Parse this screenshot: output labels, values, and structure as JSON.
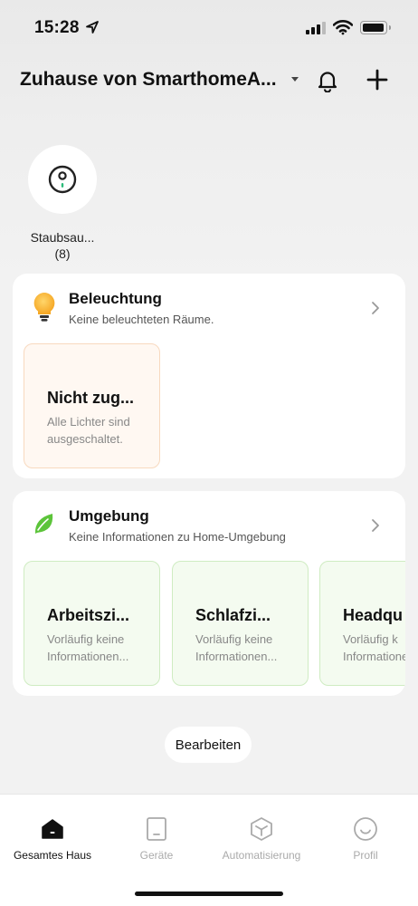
{
  "status_bar": {
    "time": "15:28"
  },
  "header": {
    "home_name": "Zuhause von SmarthomeA..."
  },
  "device_shortcut": {
    "name": "Staubsau...",
    "count": "(8)"
  },
  "lighting_card": {
    "title": "Beleuchtung",
    "subtitle": "Keine beleuchteten Räume.",
    "tiles": [
      {
        "title": "Nicht zug...",
        "sub_line1": "Alle Lichter sind",
        "sub_line2": "ausgeschaltet."
      }
    ]
  },
  "environment_card": {
    "title": "Umgebung",
    "subtitle": "Keine Informationen zu Home-Umgebung",
    "tiles": [
      {
        "title": "Arbeitszi...",
        "sub_line1": "Vorläufig keine",
        "sub_line2": "Informationen..."
      },
      {
        "title": "Schlafzi...",
        "sub_line1": "Vorläufig keine",
        "sub_line2": "Informationen..."
      },
      {
        "title": "Headqu",
        "sub_line1": "Vorläufig k",
        "sub_line2": "Informationen"
      }
    ]
  },
  "edit_button": "Bearbeiten",
  "tab_bar": {
    "tabs": [
      {
        "label": "Gesamtes Haus",
        "icon": "home-icon",
        "active": true
      },
      {
        "label": "Geräte",
        "icon": "device-icon",
        "active": false
      },
      {
        "label": "Automatisierung",
        "icon": "cube-icon",
        "active": false
      },
      {
        "label": "Profil",
        "icon": "smiley-icon",
        "active": false
      }
    ]
  },
  "colors": {
    "light_tile_bg": "#fff8f2",
    "light_tile_border": "#f8d9bf",
    "env_tile_bg": "#f4fbf0",
    "env_tile_border": "#cfecc2",
    "bulb": "#f7b733",
    "leaf": "#5cc43a",
    "active_tab": "#111111",
    "inactive_tab": "#aaaaaa"
  }
}
